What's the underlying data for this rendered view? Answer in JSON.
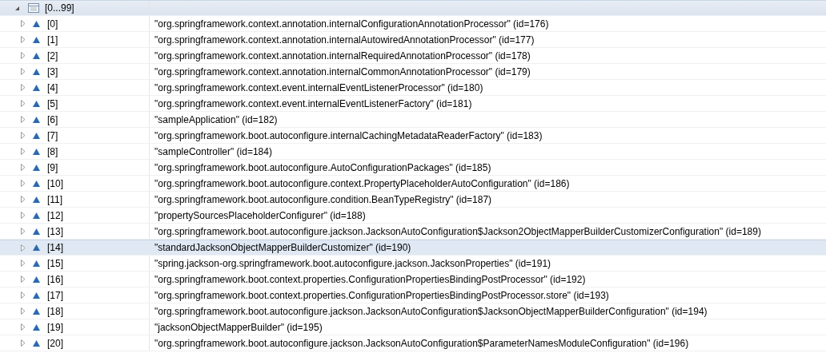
{
  "root": {
    "label": "[0...99]",
    "expanded": true,
    "selected": true
  },
  "rows": [
    {
      "index": "[0]",
      "value": "\"org.springframework.context.annotation.internalConfigurationAnnotationProcessor\" (id=176)",
      "selected": false,
      "expanded": false
    },
    {
      "index": "[1]",
      "value": "\"org.springframework.context.annotation.internalAutowiredAnnotationProcessor\" (id=177)",
      "selected": false,
      "expanded": false
    },
    {
      "index": "[2]",
      "value": "\"org.springframework.context.annotation.internalRequiredAnnotationProcessor\" (id=178)",
      "selected": false,
      "expanded": false
    },
    {
      "index": "[3]",
      "value": "\"org.springframework.context.annotation.internalCommonAnnotationProcessor\" (id=179)",
      "selected": false,
      "expanded": false
    },
    {
      "index": "[4]",
      "value": "\"org.springframework.context.event.internalEventListenerProcessor\" (id=180)",
      "selected": false,
      "expanded": false
    },
    {
      "index": "[5]",
      "value": "\"org.springframework.context.event.internalEventListenerFactory\" (id=181)",
      "selected": false,
      "expanded": false
    },
    {
      "index": "[6]",
      "value": "\"sampleApplication\" (id=182)",
      "selected": false,
      "expanded": false
    },
    {
      "index": "[7]",
      "value": "\"org.springframework.boot.autoconfigure.internalCachingMetadataReaderFactory\" (id=183)",
      "selected": false,
      "expanded": false
    },
    {
      "index": "[8]",
      "value": "\"sampleController\" (id=184)",
      "selected": false,
      "expanded": false
    },
    {
      "index": "[9]",
      "value": "\"org.springframework.boot.autoconfigure.AutoConfigurationPackages\" (id=185)",
      "selected": false,
      "expanded": false
    },
    {
      "index": "[10]",
      "value": "\"org.springframework.boot.autoconfigure.context.PropertyPlaceholderAutoConfiguration\" (id=186)",
      "selected": false,
      "expanded": false
    },
    {
      "index": "[11]",
      "value": "\"org.springframework.boot.autoconfigure.condition.BeanTypeRegistry\" (id=187)",
      "selected": false,
      "expanded": false
    },
    {
      "index": "[12]",
      "value": "\"propertySourcesPlaceholderConfigurer\" (id=188)",
      "selected": false,
      "expanded": false
    },
    {
      "index": "[13]",
      "value": "\"org.springframework.boot.autoconfigure.jackson.JacksonAutoConfiguration$Jackson2ObjectMapperBuilderCustomizerConfiguration\" (id=189)",
      "selected": false,
      "expanded": false
    },
    {
      "index": "[14]",
      "value": "\"standardJacksonObjectMapperBuilderCustomizer\" (id=190)",
      "selected": true,
      "expanded": false
    },
    {
      "index": "[15]",
      "value": "\"spring.jackson-org.springframework.boot.autoconfigure.jackson.JacksonProperties\" (id=191)",
      "selected": false,
      "expanded": false
    },
    {
      "index": "[16]",
      "value": "\"org.springframework.boot.context.properties.ConfigurationPropertiesBindingPostProcessor\" (id=192)",
      "selected": false,
      "expanded": false
    },
    {
      "index": "[17]",
      "value": "\"org.springframework.boot.context.properties.ConfigurationPropertiesBindingPostProcessor.store\" (id=193)",
      "selected": false,
      "expanded": false
    },
    {
      "index": "[18]",
      "value": "\"org.springframework.boot.autoconfigure.jackson.JacksonAutoConfiguration$JacksonObjectMapperBuilderConfiguration\" (id=194)",
      "selected": false,
      "expanded": false
    },
    {
      "index": "[19]",
      "value": "\"jacksonObjectMapperBuilder\" (id=195)",
      "selected": false,
      "expanded": false
    },
    {
      "index": "[20]",
      "value": "\"org.springframework.boot.autoconfigure.jackson.JacksonAutoConfiguration$ParameterNamesModuleConfiguration\" (id=196)",
      "selected": false,
      "expanded": false
    }
  ]
}
